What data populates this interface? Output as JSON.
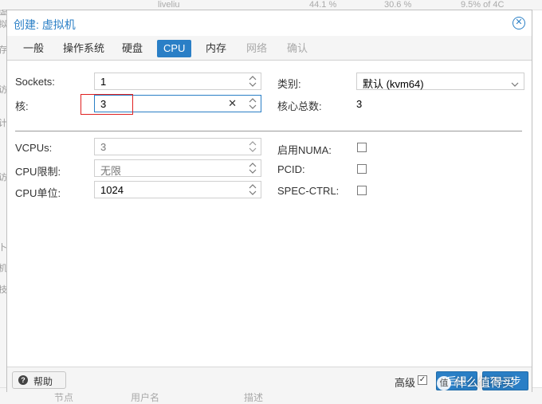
{
  "dialog": {
    "title": "创建: 虚拟机",
    "close_icon": "close-circle-icon"
  },
  "tabs": [
    {
      "label": "一般",
      "state": "normal"
    },
    {
      "label": "操作系统",
      "state": "normal"
    },
    {
      "label": "硬盘",
      "state": "normal"
    },
    {
      "label": "CPU",
      "state": "active"
    },
    {
      "label": "内存",
      "state": "normal"
    },
    {
      "label": "网络",
      "state": "disabled"
    },
    {
      "label": "确认",
      "state": "disabled"
    }
  ],
  "cpu": {
    "sockets": {
      "label": "Sockets:",
      "value": "1"
    },
    "cores": {
      "label": "核:",
      "value": "3"
    },
    "type": {
      "label": "类别:",
      "value": "默认 (kvm64)"
    },
    "total_cores": {
      "label": "核心总数:",
      "value": "3"
    },
    "vcpus": {
      "label": "VCPUs:",
      "value": "3"
    },
    "cpu_limit": {
      "label": "CPU限制:",
      "placeholder": "无限"
    },
    "cpu_units": {
      "label": "CPU单位:",
      "value": "1024"
    },
    "numa": {
      "label": "启用NUMA:",
      "checked": false
    },
    "pcid": {
      "label": "PCID:",
      "checked": false
    },
    "spec_ctrl": {
      "label": "SPEC-CTRL:",
      "checked": false
    }
  },
  "footer": {
    "help_label": "帮助",
    "help_icon": "question-circle-icon",
    "advanced_label": "高级",
    "advanced_checked": true,
    "back_label": "后退",
    "next_label": "下一步"
  },
  "watermark": {
    "text": "什么值得买",
    "icon_text": "值"
  },
  "background": {
    "top_texts": [
      "liveliu",
      "44.1 %",
      "30.6 %",
      "9.5% of 4C"
    ],
    "left_texts": [
      "虚拟",
      "存",
      "访",
      "计",
      "访",
      "卜",
      "机",
      "技"
    ],
    "bottom_texts": [
      "节点",
      "用户名",
      "描述"
    ]
  },
  "colors": {
    "accent": "#2a7fc6",
    "annotation": "#e02020"
  }
}
